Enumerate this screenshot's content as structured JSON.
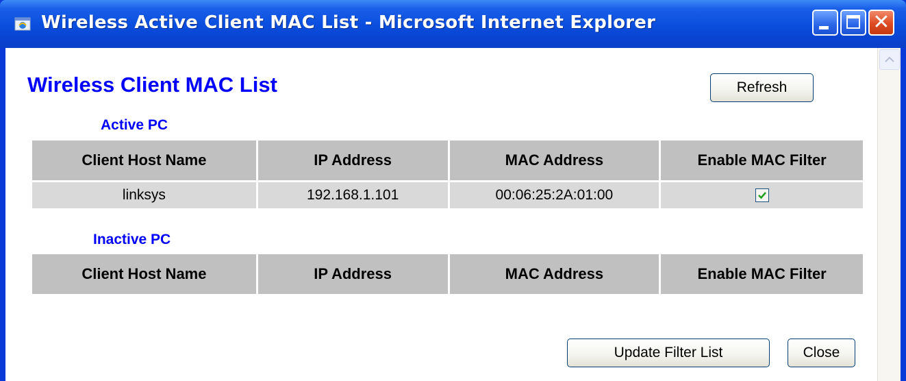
{
  "window": {
    "title": "Wireless Active Client MAC List - Microsoft Internet Explorer",
    "controls": {
      "minimize_icon": "minimize-icon",
      "maximize_icon": "maximize-icon",
      "close_icon": "close-icon",
      "close_glyph": "✕"
    }
  },
  "page": {
    "title": "Wireless Client MAC List",
    "refresh_label": "Refresh",
    "update_label": "Update Filter List",
    "close_label": "Close"
  },
  "active": {
    "label": "Active PC",
    "columns": [
      "Client Host Name",
      "IP Address",
      "MAC Address",
      "Enable MAC Filter"
    ],
    "rows": [
      {
        "host": "linksys",
        "ip": "192.168.1.101",
        "mac": "00:06:25:2A:01:00",
        "filter_enabled": true
      }
    ]
  },
  "inactive": {
    "label": "Inactive PC",
    "columns": [
      "Client Host Name",
      "IP Address",
      "MAC Address",
      "Enable MAC Filter"
    ],
    "rows": []
  },
  "colors": {
    "title_bar": "#0b4fe0",
    "heading_blue": "#0000ff",
    "header_cell": "#c0c0c0",
    "data_cell": "#d9d9d9",
    "close_button": "#de4b22"
  }
}
